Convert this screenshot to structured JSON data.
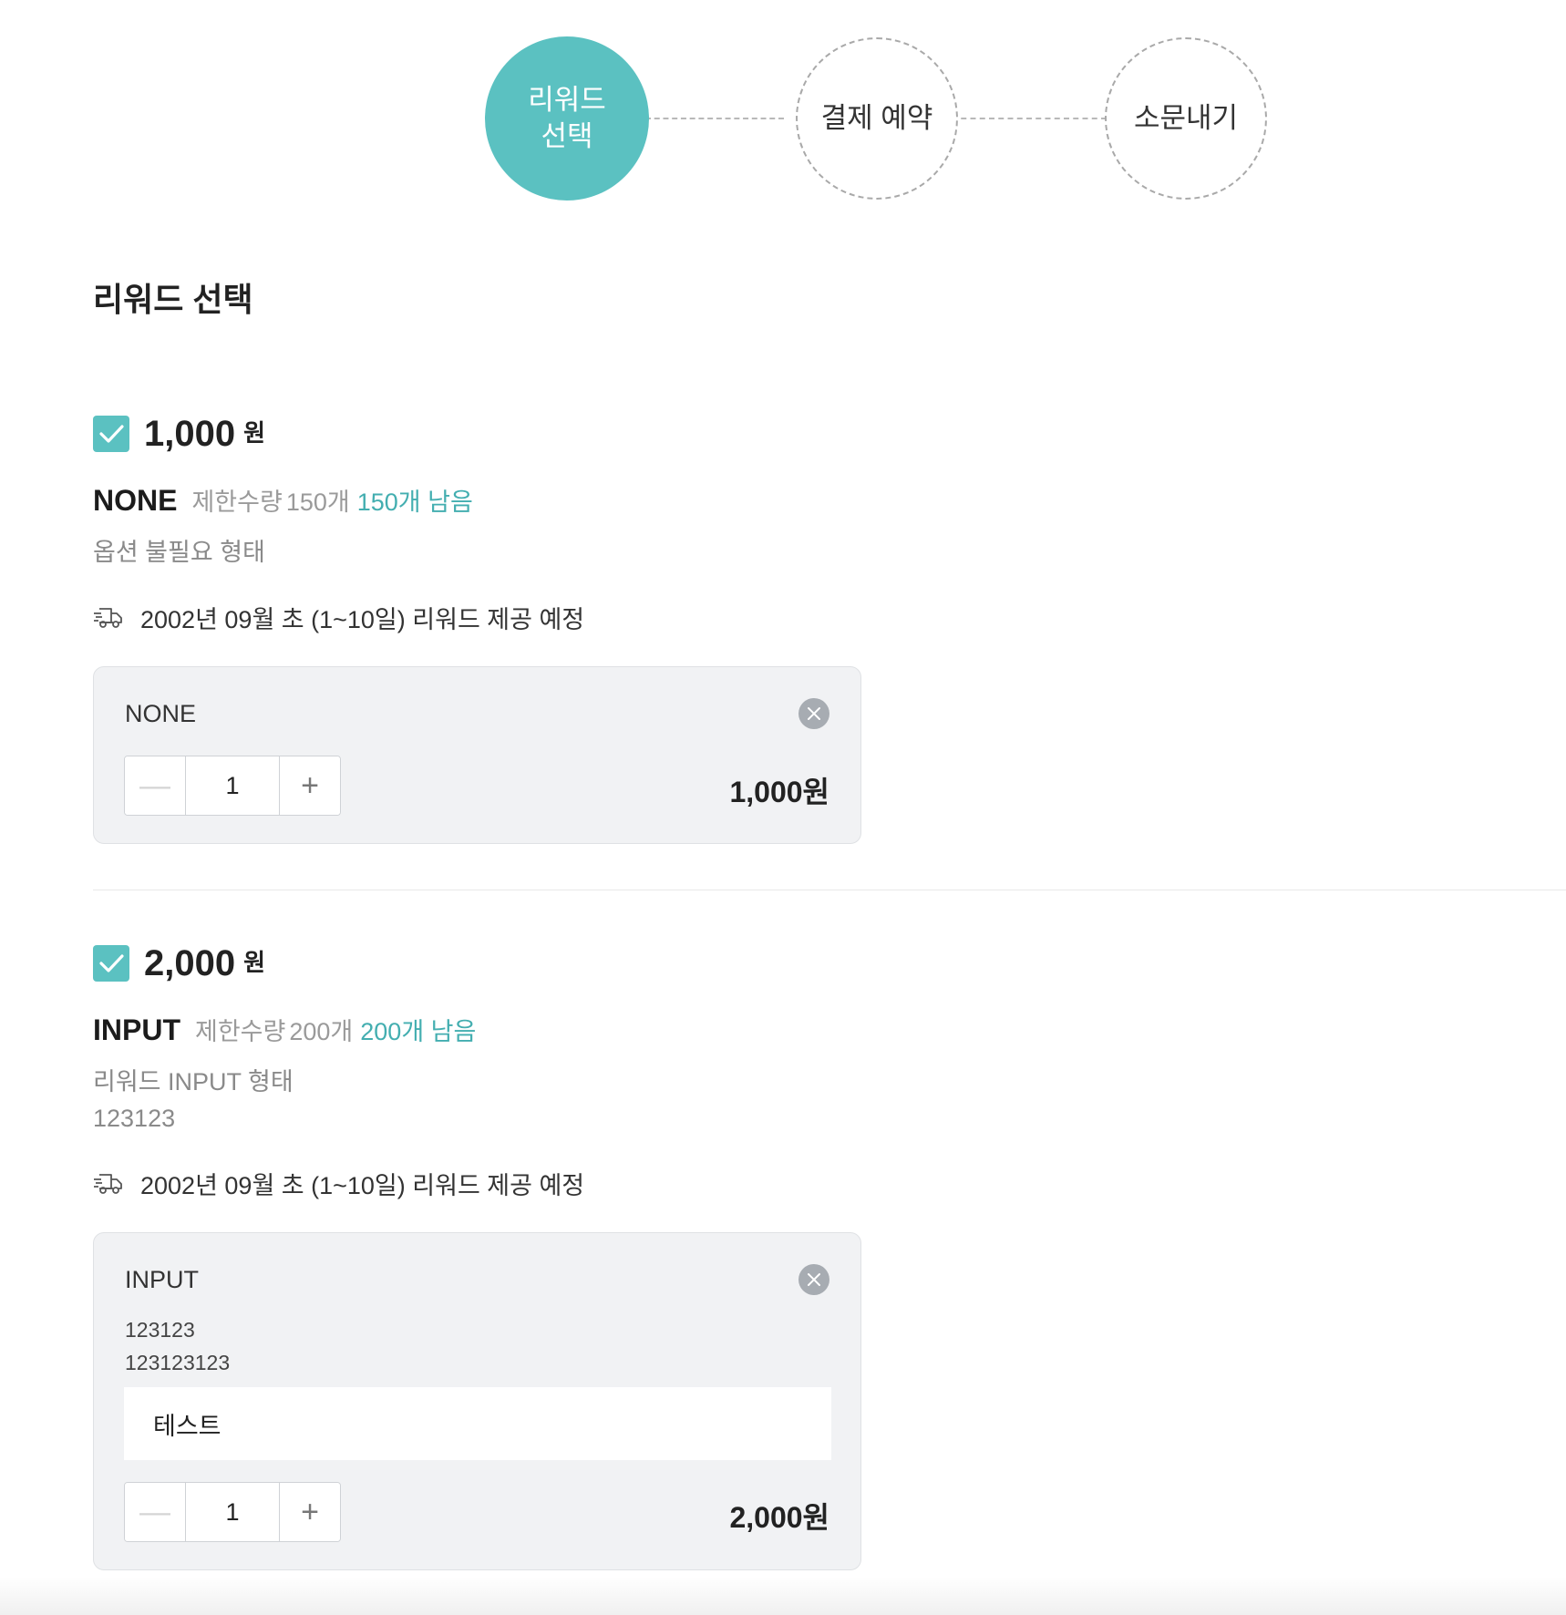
{
  "stepper": {
    "steps": [
      {
        "label": "리워드\n선택",
        "state": "active"
      },
      {
        "label": "결제 예약",
        "state": "inactive"
      },
      {
        "label": "소문내기",
        "state": "inactive"
      }
    ]
  },
  "page_title": "리워드 선택",
  "colors": {
    "accent": "#5bc1c1",
    "accent_text": "#43aeb0",
    "box_bg": "#f1f2f4"
  },
  "rewards": [
    {
      "price": "1,000",
      "unit": "원",
      "checked": true,
      "name": "NONE",
      "limit_label": "제한수량",
      "limit_count": "150개",
      "remaining": "150개 남음",
      "desc": "옵션 불필요 형태",
      "desc_extra": "",
      "delivery_icon": "truck-icon",
      "delivery": "2002년 09월 초 (1~10일) 리워드 제공 예정",
      "option": {
        "name": "NONE",
        "qty": "1",
        "minus": "—",
        "plus": "+",
        "total": "1,000원"
      }
    },
    {
      "price": "2,000",
      "unit": "원",
      "checked": true,
      "name": "INPUT",
      "limit_label": "제한수량",
      "limit_count": "200개",
      "remaining": "200개 남음",
      "desc": "리워드 INPUT 형태",
      "desc_extra": "123123",
      "delivery_icon": "truck-icon",
      "delivery": "2002년 09월 초 (1~10일) 리워드 제공 예정",
      "option": {
        "name": "INPUT",
        "extra_line1": "123123",
        "extra_line2": "123123123",
        "input_value": "테스트",
        "qty": "1",
        "minus": "—",
        "plus": "+",
        "total": "2,000원"
      }
    }
  ]
}
